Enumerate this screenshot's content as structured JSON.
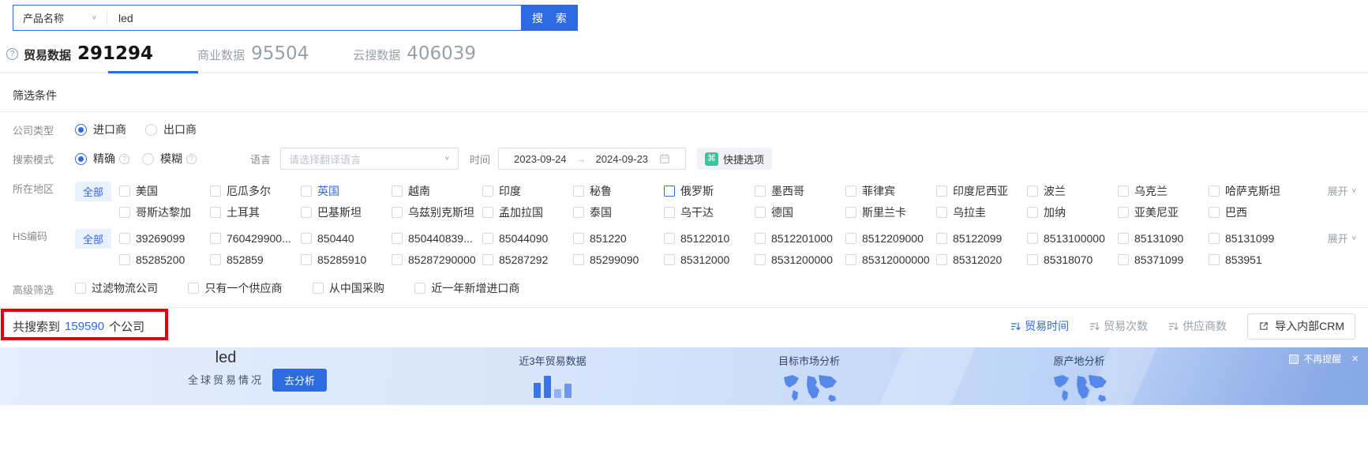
{
  "search": {
    "category": "产品名称",
    "query": "led",
    "button": "搜 索"
  },
  "tabs": [
    {
      "label": "贸易数据",
      "count": "291294",
      "active": true
    },
    {
      "label": "商业数据",
      "count": "95504",
      "active": false
    },
    {
      "label": "云搜数据",
      "count": "406039",
      "active": false
    }
  ],
  "filters": {
    "title": "筛选条件",
    "company_type": {
      "label": "公司类型",
      "import": "进口商",
      "export": "出口商"
    },
    "search_mode": {
      "label": "搜索模式",
      "exact": "精确",
      "fuzzy": "模糊",
      "language_label": "语言",
      "language_placeholder": "请选择翻译语言",
      "time_label": "时间",
      "date_start": "2023-09-24",
      "date_arrow": "→",
      "date_end": "2024-09-23",
      "quick_option": "快捷选项"
    },
    "region": {
      "label": "所在地区",
      "all": "全部",
      "expand": "展开",
      "row1": [
        {
          "label": "美国"
        },
        {
          "label": "厄瓜多尔"
        },
        {
          "label": "英国",
          "text_blue": true
        },
        {
          "label": "越南"
        },
        {
          "label": "印度"
        },
        {
          "label": "秘鲁"
        },
        {
          "label": "俄罗斯",
          "box_blue": true
        },
        {
          "label": "墨西哥"
        },
        {
          "label": "菲律宾"
        },
        {
          "label": "印度尼西亚"
        },
        {
          "label": "波兰"
        },
        {
          "label": "乌克兰"
        },
        {
          "label": "哈萨克斯坦"
        }
      ],
      "row2": [
        {
          "label": "哥斯达黎加"
        },
        {
          "label": "土耳其"
        },
        {
          "label": "巴基斯坦"
        },
        {
          "label": "乌兹别克斯坦"
        },
        {
          "label": "孟加拉国"
        },
        {
          "label": "泰国"
        },
        {
          "label": "乌干达"
        },
        {
          "label": "德国"
        },
        {
          "label": "斯里兰卡"
        },
        {
          "label": "乌拉圭"
        },
        {
          "label": "加纳"
        },
        {
          "label": "亚美尼亚"
        },
        {
          "label": "巴西"
        }
      ]
    },
    "hs_code": {
      "label": "HS编码",
      "all": "全部",
      "expand": "展开",
      "row1": [
        {
          "label": "39269099"
        },
        {
          "label": "760429900..."
        },
        {
          "label": "850440"
        },
        {
          "label": "850440839..."
        },
        {
          "label": "85044090"
        },
        {
          "label": "851220"
        },
        {
          "label": "85122010"
        },
        {
          "label": "8512201000"
        },
        {
          "label": "8512209000"
        },
        {
          "label": "85122099"
        },
        {
          "label": "8513100000"
        },
        {
          "label": "85131090"
        },
        {
          "label": "85131099"
        }
      ],
      "row2": [
        {
          "label": "85285200"
        },
        {
          "label": "852859"
        },
        {
          "label": "85285910"
        },
        {
          "label": "85287290000"
        },
        {
          "label": "85287292"
        },
        {
          "label": "85299090"
        },
        {
          "label": "85312000"
        },
        {
          "label": "8531200000"
        },
        {
          "label": "85312000000"
        },
        {
          "label": "85312020"
        },
        {
          "label": "85318070"
        },
        {
          "label": "85371099"
        },
        {
          "label": "853951"
        }
      ]
    },
    "advanced": {
      "label": "高级筛选",
      "options": [
        "过滤物流公司",
        "只有一个供应商",
        "从中国采购",
        "近一年新增进口商"
      ]
    }
  },
  "results": {
    "prefix": "共搜索到",
    "count": "159590",
    "suffix": "个公司",
    "sorts": [
      {
        "label": "贸易时间",
        "active": true
      },
      {
        "label": "贸易次数",
        "active": false
      },
      {
        "label": "供应商数",
        "active": false
      }
    ],
    "crm_button": "导入内部CRM"
  },
  "banner": {
    "keyword": "led",
    "subtitle": "全球贸易情况",
    "analyze": "去分析",
    "card_trade": "近3年贸易数据",
    "card_market": "目标市场分析",
    "card_origin": "原产地分析",
    "dismiss": "不再提醒",
    "close": "×"
  },
  "icons": {
    "chevron_down": "∨",
    "command": "⌘",
    "question": "?"
  },
  "colors": {
    "primary": "#2E6BE0",
    "annotation_red": "#E3000F",
    "quick_icon_green": "#3FC49A"
  }
}
